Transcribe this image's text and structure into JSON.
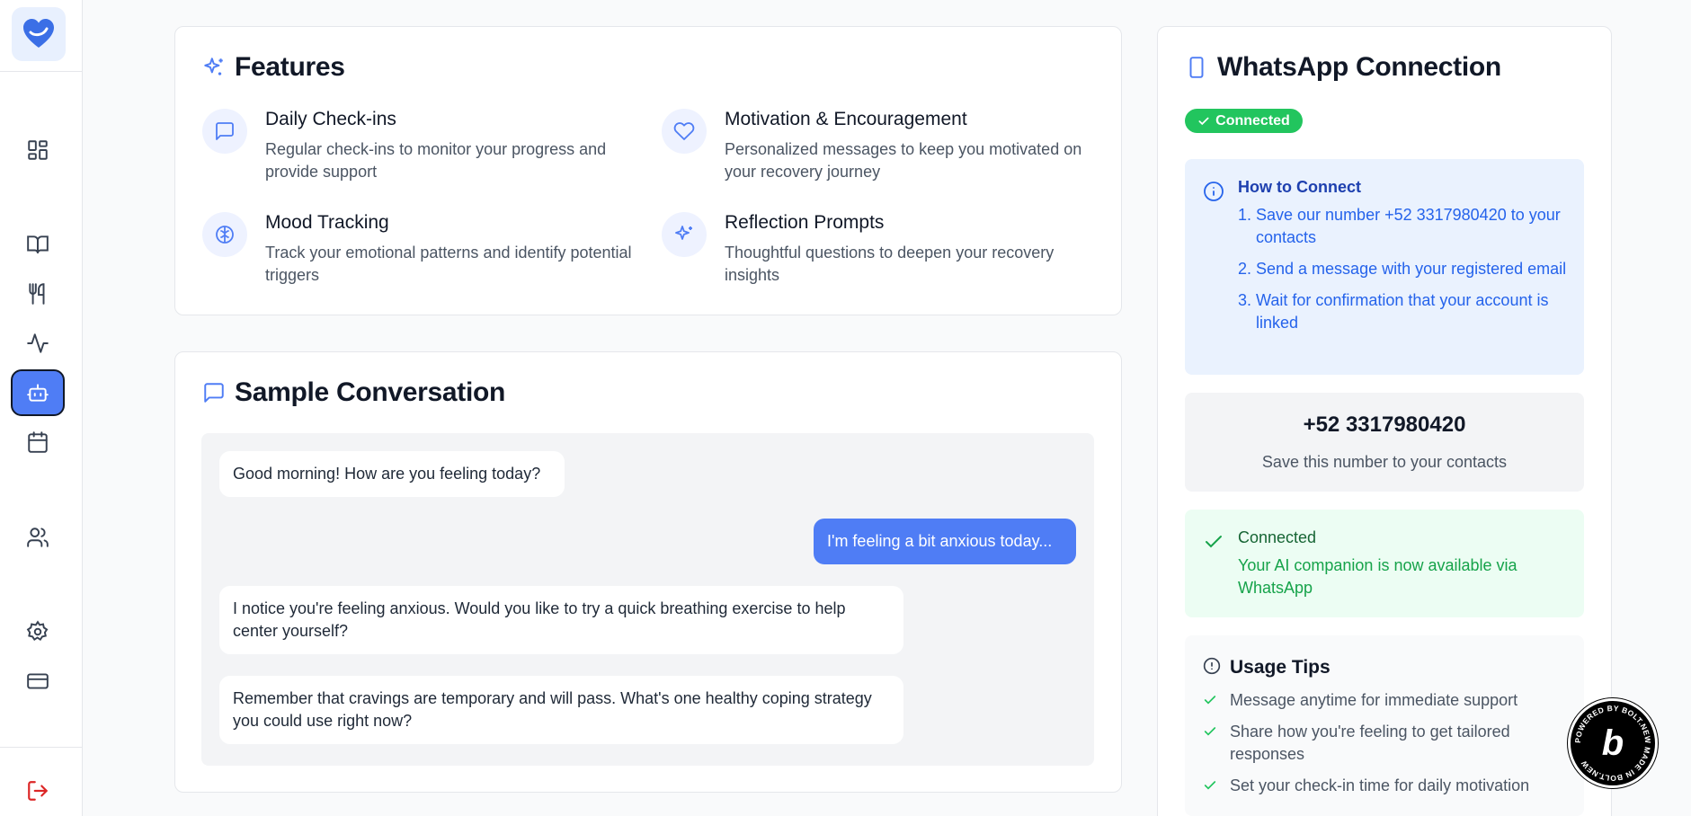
{
  "sidebar": {
    "logo_icon": "heart-logo-icon",
    "items": [
      {
        "name": "dashboard",
        "icon": "grid-icon"
      },
      {
        "name": "journal",
        "icon": "book-icon"
      },
      {
        "name": "nutrition",
        "icon": "utensils-icon"
      },
      {
        "name": "activity",
        "icon": "pulse-icon"
      },
      {
        "name": "ai-companion",
        "icon": "bot-icon",
        "active": true
      },
      {
        "name": "calendar",
        "icon": "calendar-icon"
      },
      {
        "name": "community",
        "icon": "users-icon"
      },
      {
        "name": "settings",
        "icon": "gear-icon"
      },
      {
        "name": "billing",
        "icon": "credit-card-icon"
      },
      {
        "name": "logout",
        "icon": "logout-icon"
      }
    ]
  },
  "features": {
    "title": "Features",
    "items": [
      {
        "title": "Daily Check-ins",
        "desc": "Regular check-ins to monitor your progress and provide support",
        "icon": "message-square-icon"
      },
      {
        "title": "Motivation & Encouragement",
        "desc": "Personalized messages to keep you motivated on your recovery journey",
        "icon": "heart-icon"
      },
      {
        "title": "Mood Tracking",
        "desc": "Track your emotional patterns and identify potential triggers",
        "icon": "brain-icon"
      },
      {
        "title": "Reflection Prompts",
        "desc": "Thoughtful questions to deepen your recovery insights",
        "icon": "sparkles-icon"
      }
    ]
  },
  "conversation": {
    "title": "Sample Conversation",
    "messages": [
      {
        "from": "bot",
        "text": "Good morning! How are you feeling today?"
      },
      {
        "from": "user",
        "text": "I'm feeling a bit anxious today..."
      },
      {
        "from": "bot",
        "text": "I notice you're feeling anxious. Would you like to try a quick breathing exercise to help center yourself?"
      },
      {
        "from": "bot",
        "text": "Remember that cravings are temporary and will pass. What's one healthy coping strategy you could use right now?"
      }
    ]
  },
  "whatsapp": {
    "title": "WhatsApp Connection",
    "status_badge": "Connected",
    "how_to": {
      "title": "How to Connect",
      "steps": [
        "Save our number +52 3317980420 to your contacts",
        "Send a message with your registered email",
        "Wait for confirmation that your account is linked"
      ]
    },
    "number": "+52 3317980420",
    "number_hint": "Save this number to your contacts",
    "connected": {
      "title": "Connected",
      "desc": "Your AI companion is now available via WhatsApp"
    },
    "tips": {
      "title": "Usage Tips",
      "items": [
        "Message anytime for immediate support",
        "Share how you're feeling to get tailored responses",
        "Set your check-in time for daily motivation"
      ]
    }
  },
  "colors": {
    "accent": "#4f7df5",
    "success": "#22c55e",
    "danger": "#dc2626"
  }
}
